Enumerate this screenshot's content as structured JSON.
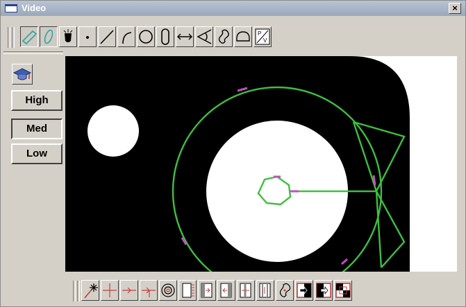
{
  "window": {
    "title": "Video",
    "close_label": "×"
  },
  "toolbar_top": {
    "buttons": [
      {
        "name": "measure-distance-icon",
        "active": true
      },
      {
        "name": "measure-probe-icon",
        "active": true
      },
      {
        "name": "auto-measure-icon"
      },
      {
        "name": "point-icon"
      },
      {
        "name": "line-icon"
      },
      {
        "name": "arc-icon"
      },
      {
        "name": "circle-icon"
      },
      {
        "name": "slot-icon"
      },
      {
        "name": "distance-icon"
      },
      {
        "name": "angle-icon"
      },
      {
        "name": "contour-icon"
      },
      {
        "name": "blob-icon"
      },
      {
        "name": "pv-icon",
        "label": "P/V"
      }
    ]
  },
  "left_panel": {
    "mortarboard_label": "",
    "buttons": [
      {
        "label": "High"
      },
      {
        "label": "Med",
        "pressed": true
      },
      {
        "label": "Low"
      }
    ]
  },
  "bottom_toolbar": {
    "buttons": [
      {
        "name": "wand-icon"
      },
      {
        "name": "crosshair-icon"
      },
      {
        "name": "edge-right-icon"
      },
      {
        "name": "edge-down-icon"
      },
      {
        "name": "target-icon"
      },
      {
        "name": "edge-scan-1-icon"
      },
      {
        "name": "edge-scan-2-icon"
      },
      {
        "name": "edge-scan-3-icon"
      },
      {
        "name": "edge-scan-4-icon"
      },
      {
        "name": "edge-scan-5-icon"
      },
      {
        "name": "contour-probe-icon"
      },
      {
        "name": "lighting-1-icon"
      },
      {
        "name": "lighting-2-icon"
      },
      {
        "name": "lighting-3-icon"
      }
    ]
  },
  "colors": {
    "overlay": "#3fbf3f",
    "accent": "#c050c0",
    "part": "#000000"
  }
}
